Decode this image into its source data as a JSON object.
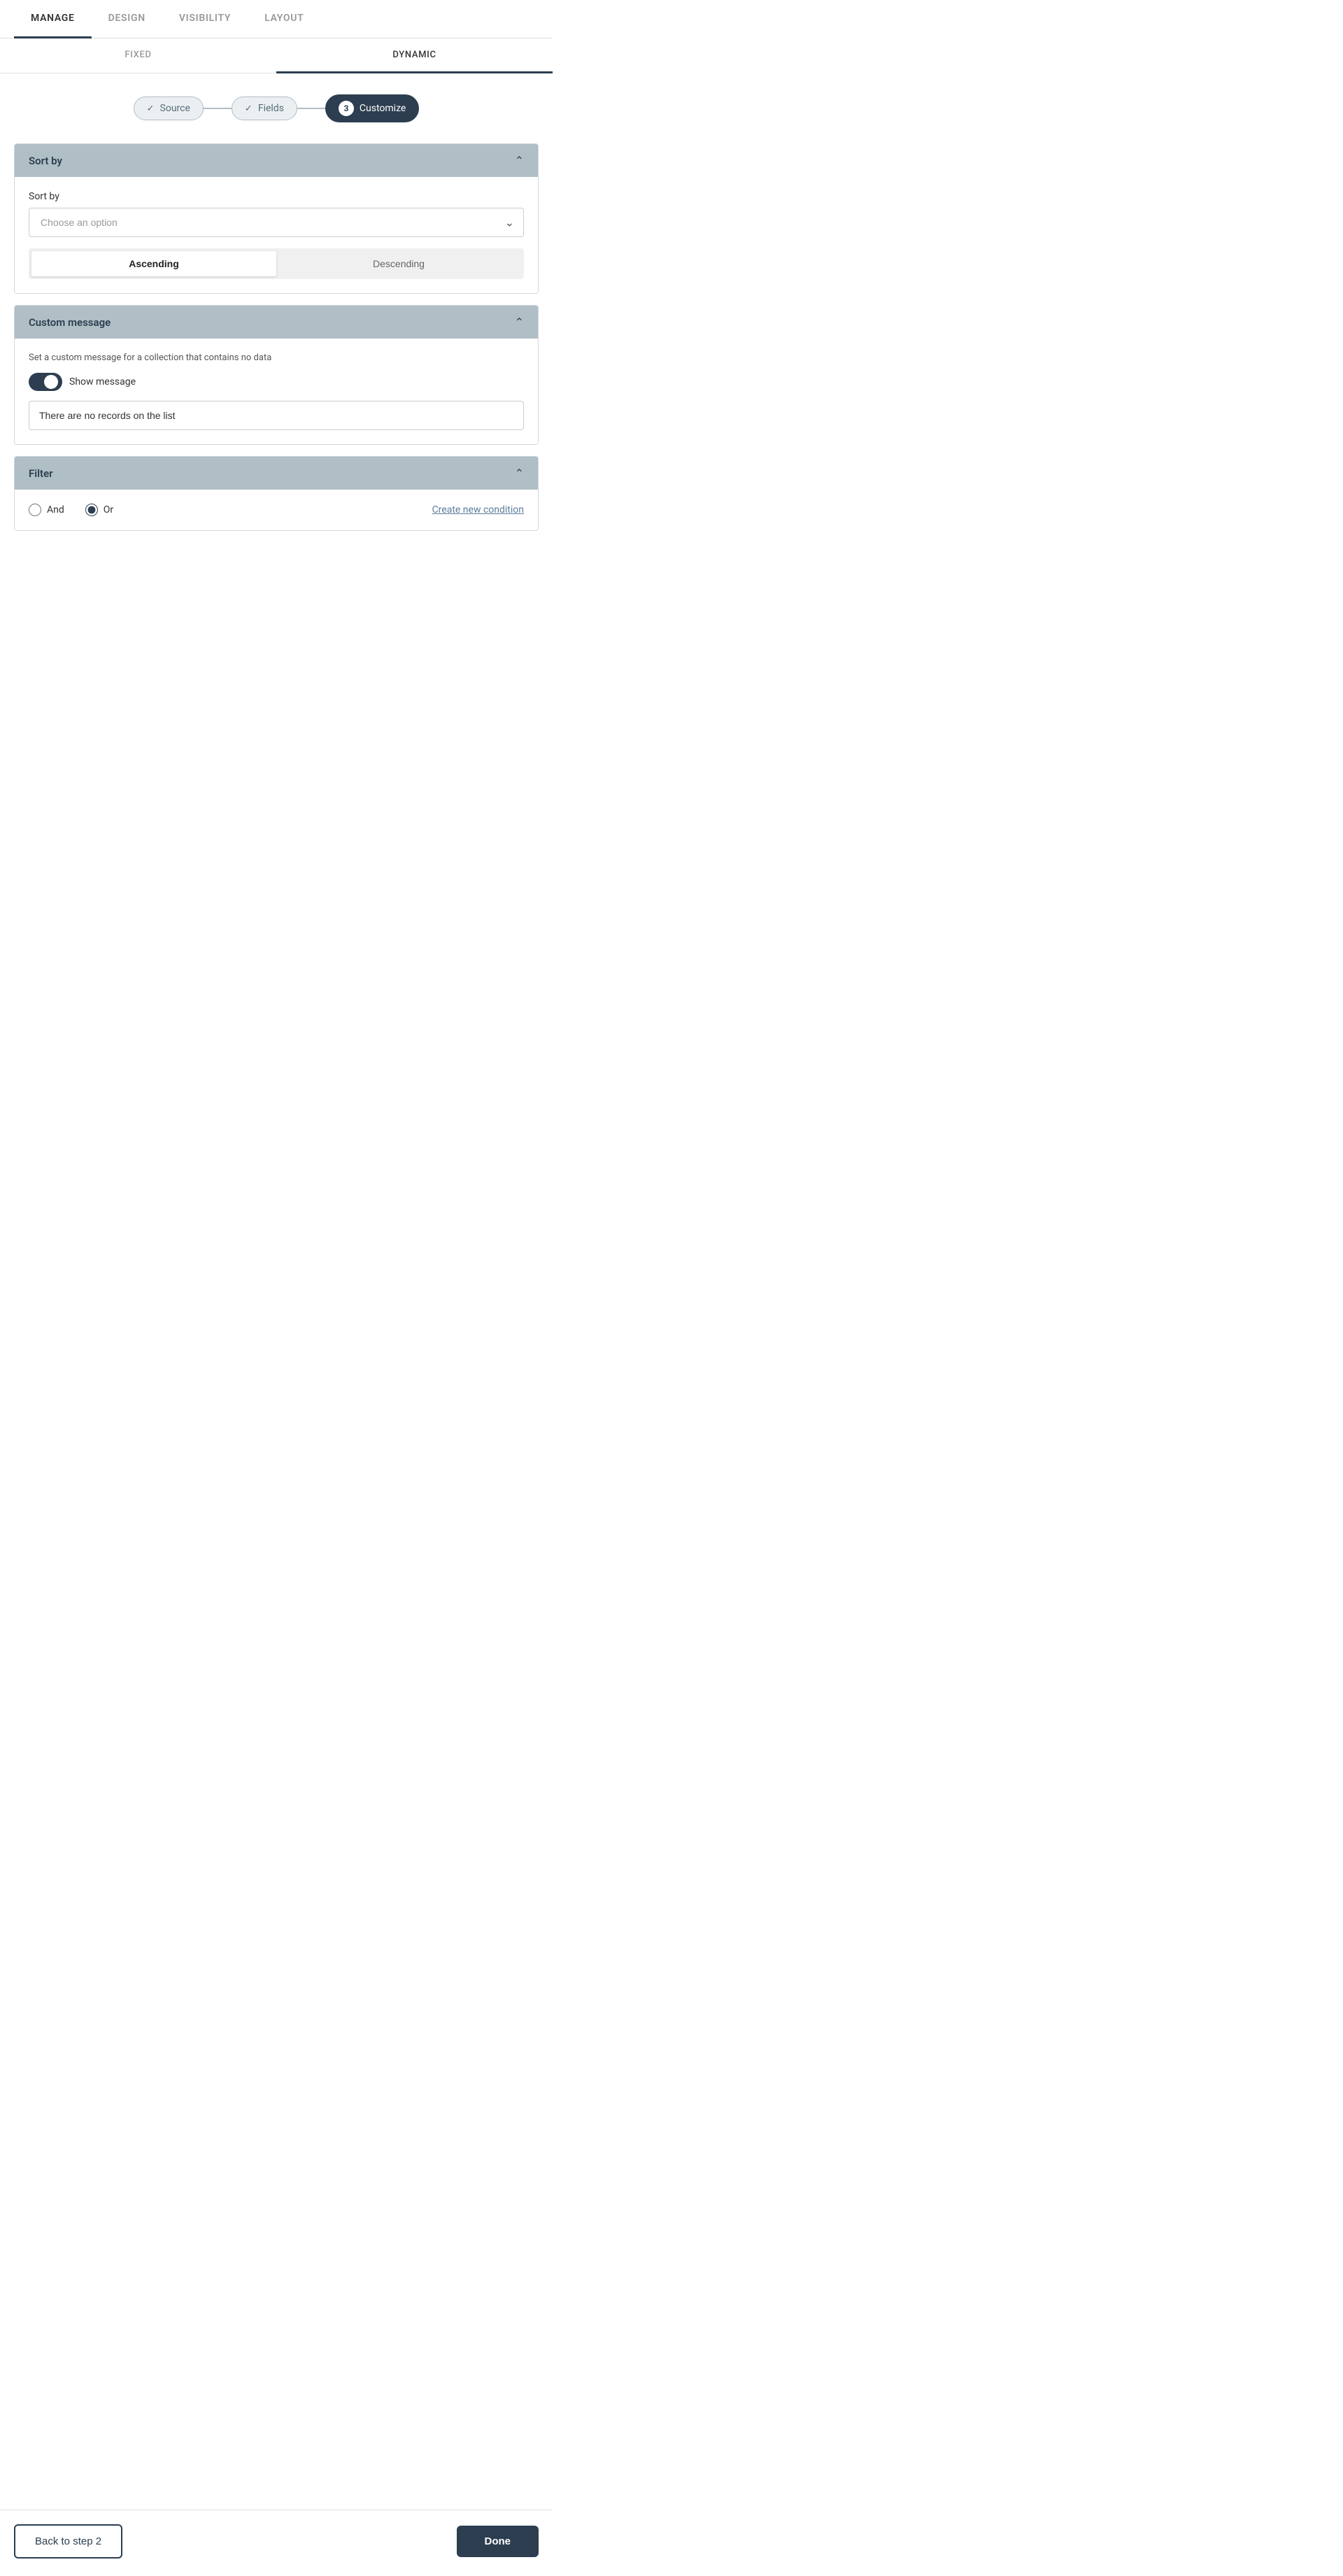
{
  "topNav": {
    "items": [
      {
        "label": "MANAGE",
        "active": true
      },
      {
        "label": "DESIGN",
        "active": false
      },
      {
        "label": "VISIBILITY",
        "active": false
      },
      {
        "label": "LAYOUT",
        "active": false
      }
    ]
  },
  "subTabs": {
    "items": [
      {
        "label": "FIXED",
        "active": false
      },
      {
        "label": "DYNAMIC",
        "active": true
      }
    ]
  },
  "steps": {
    "items": [
      {
        "label": "Source",
        "completed": true,
        "number": null,
        "checkmark": "✓"
      },
      {
        "label": "Fields",
        "completed": true,
        "number": null,
        "checkmark": "✓"
      },
      {
        "label": "Customize",
        "completed": false,
        "number": "3",
        "active": true
      }
    ]
  },
  "sortBy": {
    "sectionTitle": "Sort by",
    "fieldLabel": "Sort by",
    "selectPlaceholder": "Choose an option",
    "ascendingLabel": "Ascending",
    "descendingLabel": "Descending"
  },
  "customMessage": {
    "sectionTitle": "Custom message",
    "description": "Set a custom message for a collection that contains no data",
    "toggleLabel": "Show message",
    "messageValue": "There are no records on the list"
  },
  "filter": {
    "sectionTitle": "Filter",
    "andLabel": "And",
    "orLabel": "Or",
    "createConditionLabel": "Create new condition"
  },
  "bottomBar": {
    "backLabel": "Back to step 2",
    "doneLabel": "Done"
  }
}
